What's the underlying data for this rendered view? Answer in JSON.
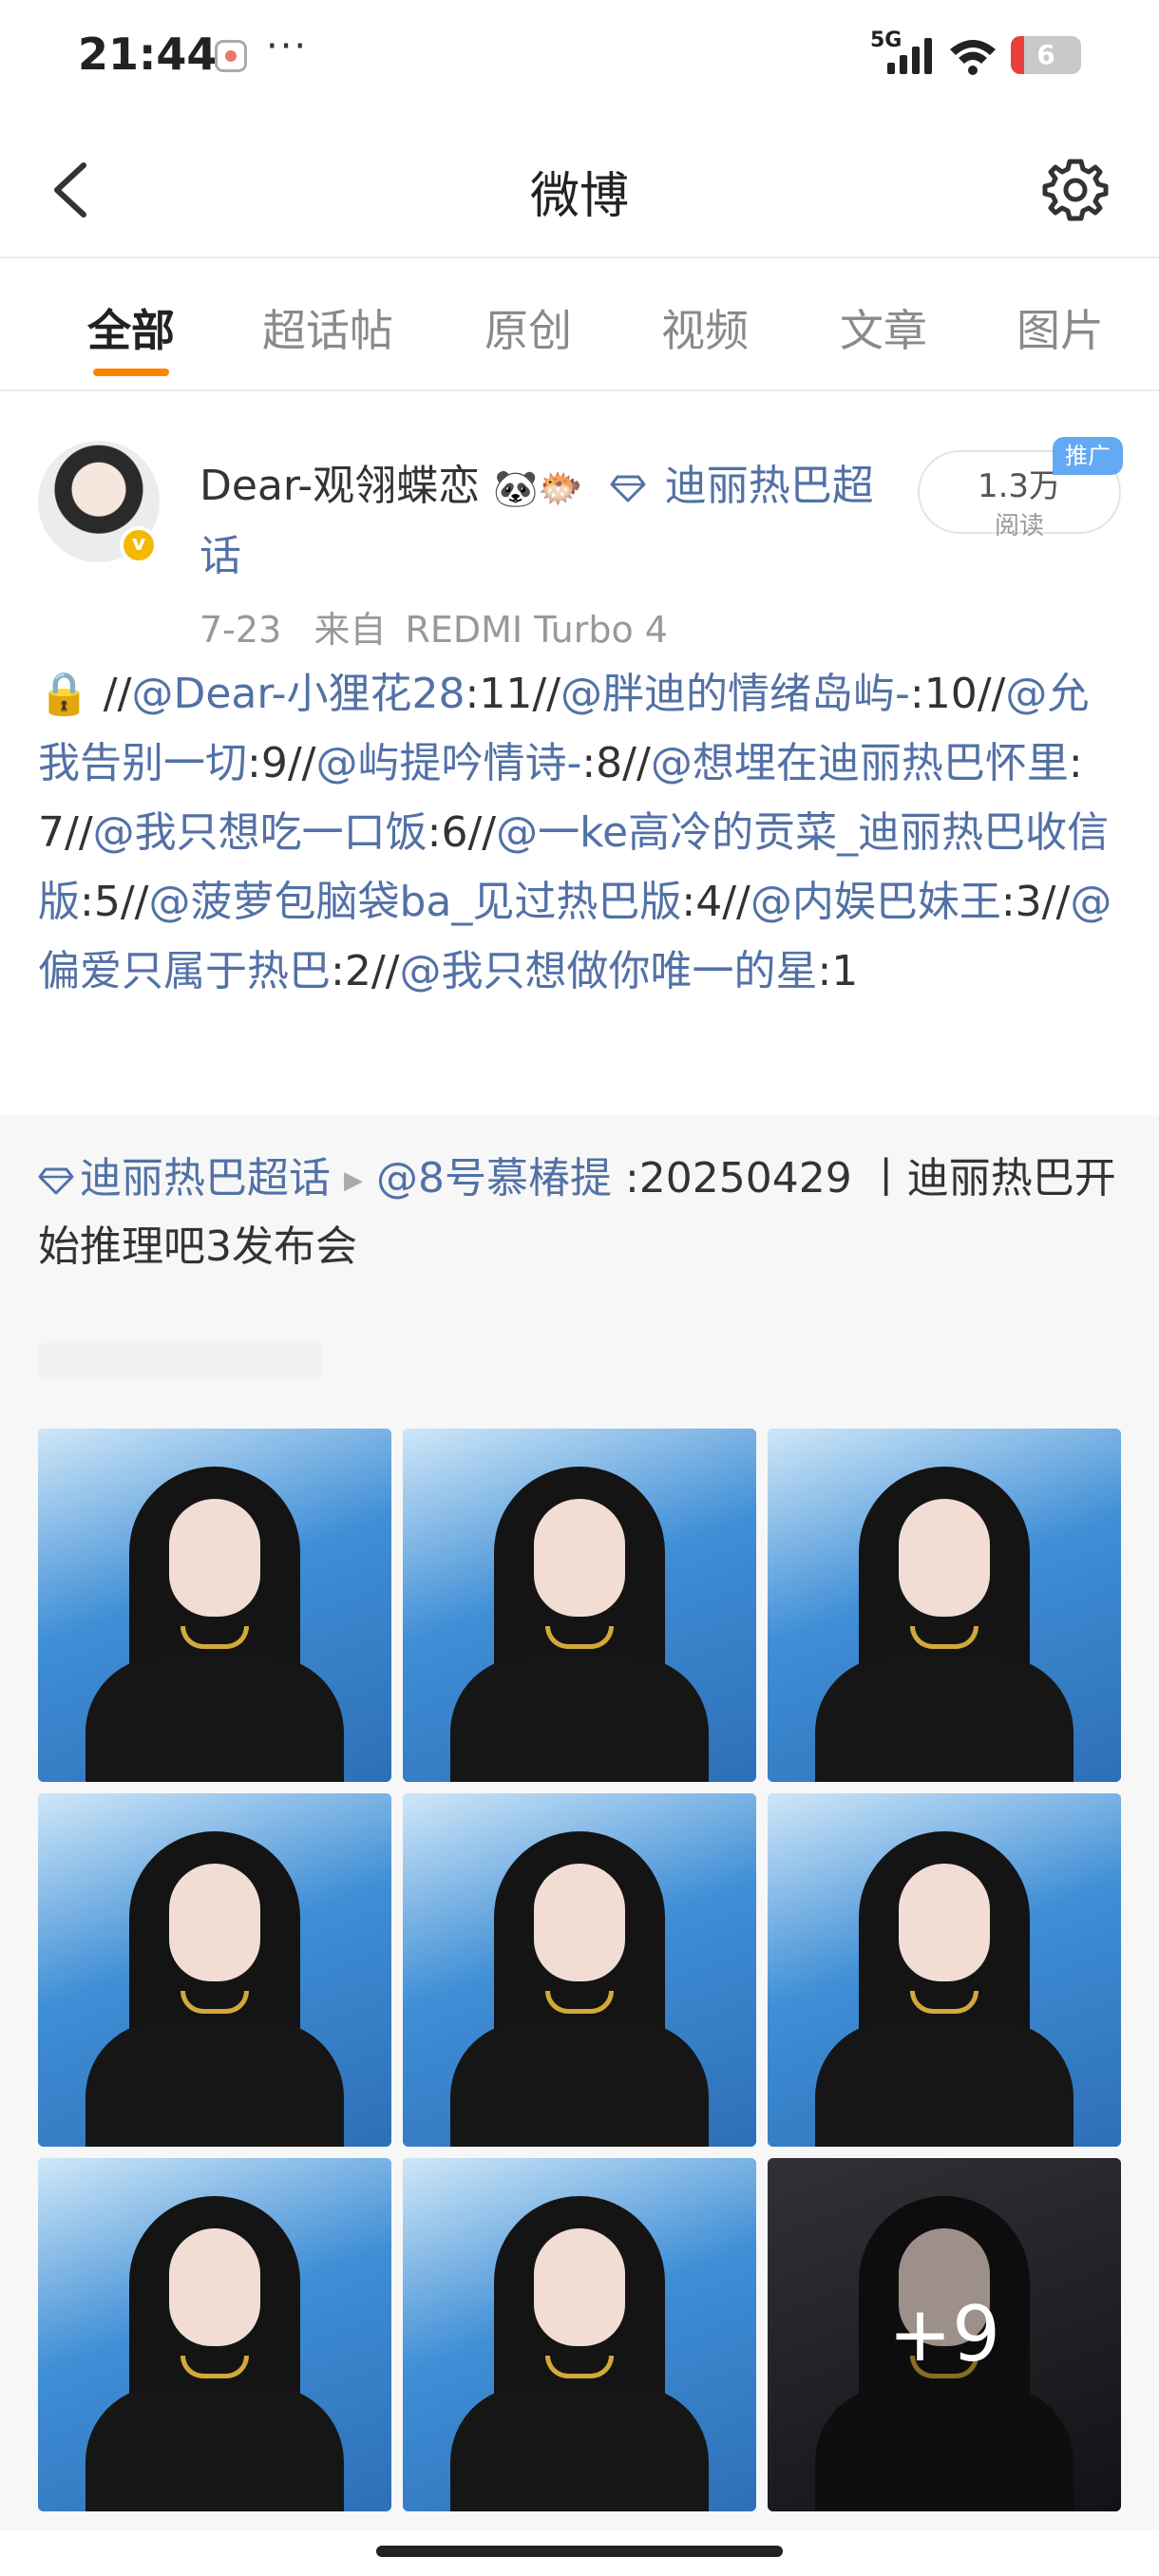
{
  "status_bar": {
    "time": "21:44",
    "more": "···",
    "network": "5G",
    "battery": "6",
    "battery_level_percent": 6
  },
  "header": {
    "back_icon": "chevron-left-icon",
    "title": "微博",
    "settings_icon": "gear-icon"
  },
  "tabs": [
    {
      "label": "全部",
      "active": true
    },
    {
      "label": "超话帖",
      "active": false
    },
    {
      "label": "原创",
      "active": false
    },
    {
      "label": "视频",
      "active": false
    },
    {
      "label": "文章",
      "active": false
    },
    {
      "label": "图片",
      "active": false
    }
  ],
  "post": {
    "username": "Dear-观翎蝶恋",
    "username_emojis": "🐼🐡",
    "topic": "迪丽热巴超话",
    "date": "7-23",
    "source_prefix": "来自",
    "source": "REDMI Turbo 4",
    "read_count": "1.3万",
    "read_label": "阅读",
    "promo_tag": "推广",
    "body_lock": "🔒",
    "body_segments": [
      {
        "text": "//",
        "link": false
      },
      {
        "text": "@Dear-小狸花28",
        "link": true
      },
      {
        "text": ":11//",
        "link": false
      },
      {
        "text": "@胖迪的情绪岛屿-",
        "link": true
      },
      {
        "text": ":10//",
        "link": false
      },
      {
        "text": "@允我告别一切",
        "link": true
      },
      {
        "text": ":9//",
        "link": false
      },
      {
        "text": "@屿提吟情诗-",
        "link": true
      },
      {
        "text": ":8//",
        "link": false
      },
      {
        "text": "@想埋在迪丽热巴怀里",
        "link": true
      },
      {
        "text": ":7//",
        "link": false
      },
      {
        "text": "@我只想吃一口饭",
        "link": true
      },
      {
        "text": ":6//",
        "link": false
      },
      {
        "text": "@一ke高冷的贡菜_迪丽热巴收信版",
        "link": true
      },
      {
        "text": ":5//",
        "link": false
      },
      {
        "text": "@菠萝包脑袋ba_见过热巴版",
        "link": true
      },
      {
        "text": ":4//",
        "link": false
      },
      {
        "text": "@内娱巴妹王",
        "link": true
      },
      {
        "text": ":3//",
        "link": false
      },
      {
        "text": "@偏爱只属于热巴",
        "link": true
      },
      {
        "text": ":2//",
        "link": false
      },
      {
        "text": "@我只想做你唯一的星",
        "link": true
      },
      {
        "text": ":1",
        "link": false
      }
    ]
  },
  "repost": {
    "topic": "迪丽热巴超话",
    "author": "@8号慕椿提",
    "text": " :20250429 丨迪丽热巴开始推理吧3发布会",
    "photos": [
      {
        "name": "photo-1",
        "overlay": ""
      },
      {
        "name": "photo-2",
        "overlay": ""
      },
      {
        "name": "photo-3",
        "overlay": ""
      },
      {
        "name": "photo-4",
        "overlay": ""
      },
      {
        "name": "photo-5",
        "overlay": ""
      },
      {
        "name": "photo-6",
        "overlay": ""
      },
      {
        "name": "photo-7",
        "overlay": ""
      },
      {
        "name": "photo-8",
        "overlay": ""
      },
      {
        "name": "photo-9",
        "overlay": "+9"
      }
    ]
  },
  "colors": {
    "accent": "#ff8200",
    "link": "#5271a6",
    "promo": "#63a9f3"
  }
}
